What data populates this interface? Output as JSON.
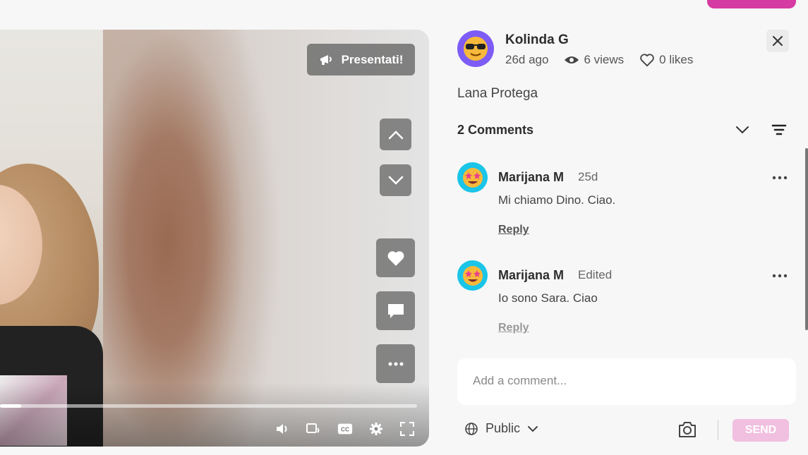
{
  "video": {
    "present_label": "Presentati!",
    "progress": 0.05
  },
  "post": {
    "author": "Kolinda G",
    "time_ago": "26d ago",
    "views": "6 views",
    "likes": "0 likes",
    "text": "Lana Protega"
  },
  "comments": {
    "title": "2 Comments",
    "items": [
      {
        "author": "Marijana M",
        "time": "25d",
        "text": "Mi chiamo Dino. Ciao.",
        "reply_label": "Reply"
      },
      {
        "author": "Marijana M",
        "time": "Edited",
        "text": "Io sono Sara. Ciao",
        "reply_label": "Reply"
      }
    ]
  },
  "composer": {
    "placeholder": "Add a comment...",
    "visibility": "Public",
    "send_label": "SEND"
  },
  "colors": {
    "brand_pink": "#d63aa3",
    "send_disabled": "#f1bfe0",
    "avatar_purple": "#7d5cf5",
    "avatar_cyan": "#1ac5e8"
  }
}
